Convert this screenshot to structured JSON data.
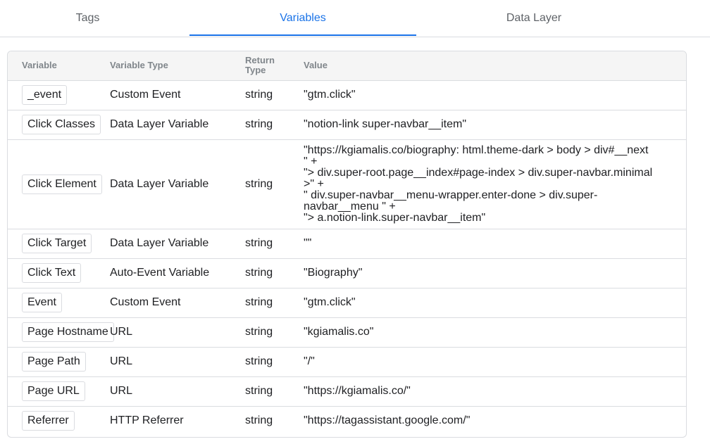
{
  "tabs": [
    {
      "label": "Tags"
    },
    {
      "label": "Variables"
    },
    {
      "label": "Data Layer"
    }
  ],
  "active_tab": "Variables",
  "table": {
    "headers": {
      "variable": "Variable",
      "variable_type": "Variable Type",
      "return_type_line1": "Return",
      "return_type_line2": "Type",
      "value": "Value"
    },
    "rows": [
      {
        "variable": "_event",
        "type": "Custom Event",
        "return_type": "string",
        "value": "\"gtm.click\""
      },
      {
        "variable": "Click Classes",
        "type": "Data Layer Variable",
        "return_type": "string",
        "value": "\"notion-link super-navbar__item\""
      },
      {
        "variable": "Click Element",
        "type": "Data Layer Variable",
        "return_type": "string",
        "value_lines": [
          "\"https://kgiamalis.co/biography: html.theme-dark > body > div#__next",
          "\" +",
          "\"> div.super-root.page__index#page-index > div.super-navbar.minimal",
          ">\" +",
          "\" div.super-navbar__menu-wrapper.enter-done > div.super-",
          "navbar__menu \" +",
          "\"> a.notion-link.super-navbar__item\""
        ]
      },
      {
        "variable": "Click Target",
        "type": "Data Layer Variable",
        "return_type": "string",
        "value": "\"\""
      },
      {
        "variable": "Click Text",
        "type": "Auto-Event Variable",
        "return_type": "string",
        "value": "\"Biography\""
      },
      {
        "variable": "Event",
        "type": "Custom Event",
        "return_type": "string",
        "value": "\"gtm.click\""
      },
      {
        "variable": "Page Hostname",
        "type": "URL",
        "return_type": "string",
        "value": "\"kgiamalis.co\""
      },
      {
        "variable": "Page Path",
        "type": "URL",
        "return_type": "string",
        "value": "\"/\""
      },
      {
        "variable": "Page URL",
        "type": "URL",
        "return_type": "string",
        "value": "\"https://kgiamalis.co/\""
      },
      {
        "variable": "Referrer",
        "type": "HTTP Referrer",
        "return_type": "string",
        "value": "\"https://tagassistant.google.com/\""
      }
    ]
  },
  "colors": {
    "accent": "#1a73e8",
    "border": "#dadce0",
    "header_bg": "#f5f5f5",
    "muted_text": "#5f6368"
  }
}
